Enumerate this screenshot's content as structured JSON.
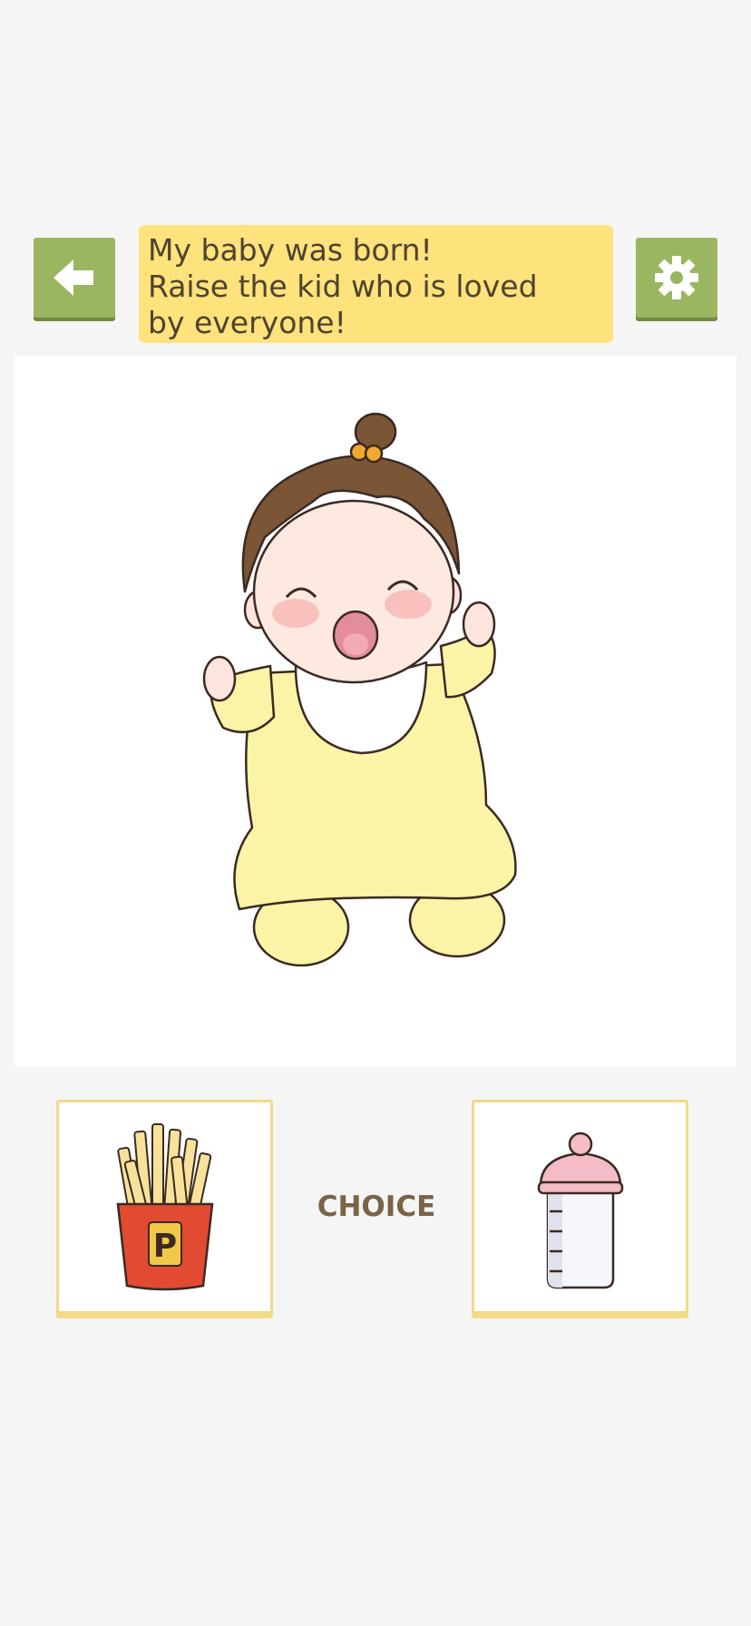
{
  "header": {
    "message_lines": [
      "My baby was born!",
      "Raise the kid who is loved",
      "by everyone!"
    ],
    "back_icon": "arrow-left-icon",
    "settings_icon": "gear-icon"
  },
  "scene": {
    "character": "baby-in-yellow-onesie"
  },
  "choices": {
    "label": "CHOICE",
    "left_option_icon": "french-fries-icon",
    "left_option_badge": "P",
    "right_option_icon": "baby-bottle-icon"
  },
  "colors": {
    "button_green": "#9ab660",
    "message_yellow": "#fee27b",
    "card_border": "#f3d98a",
    "choice_text": "#7a6346"
  }
}
